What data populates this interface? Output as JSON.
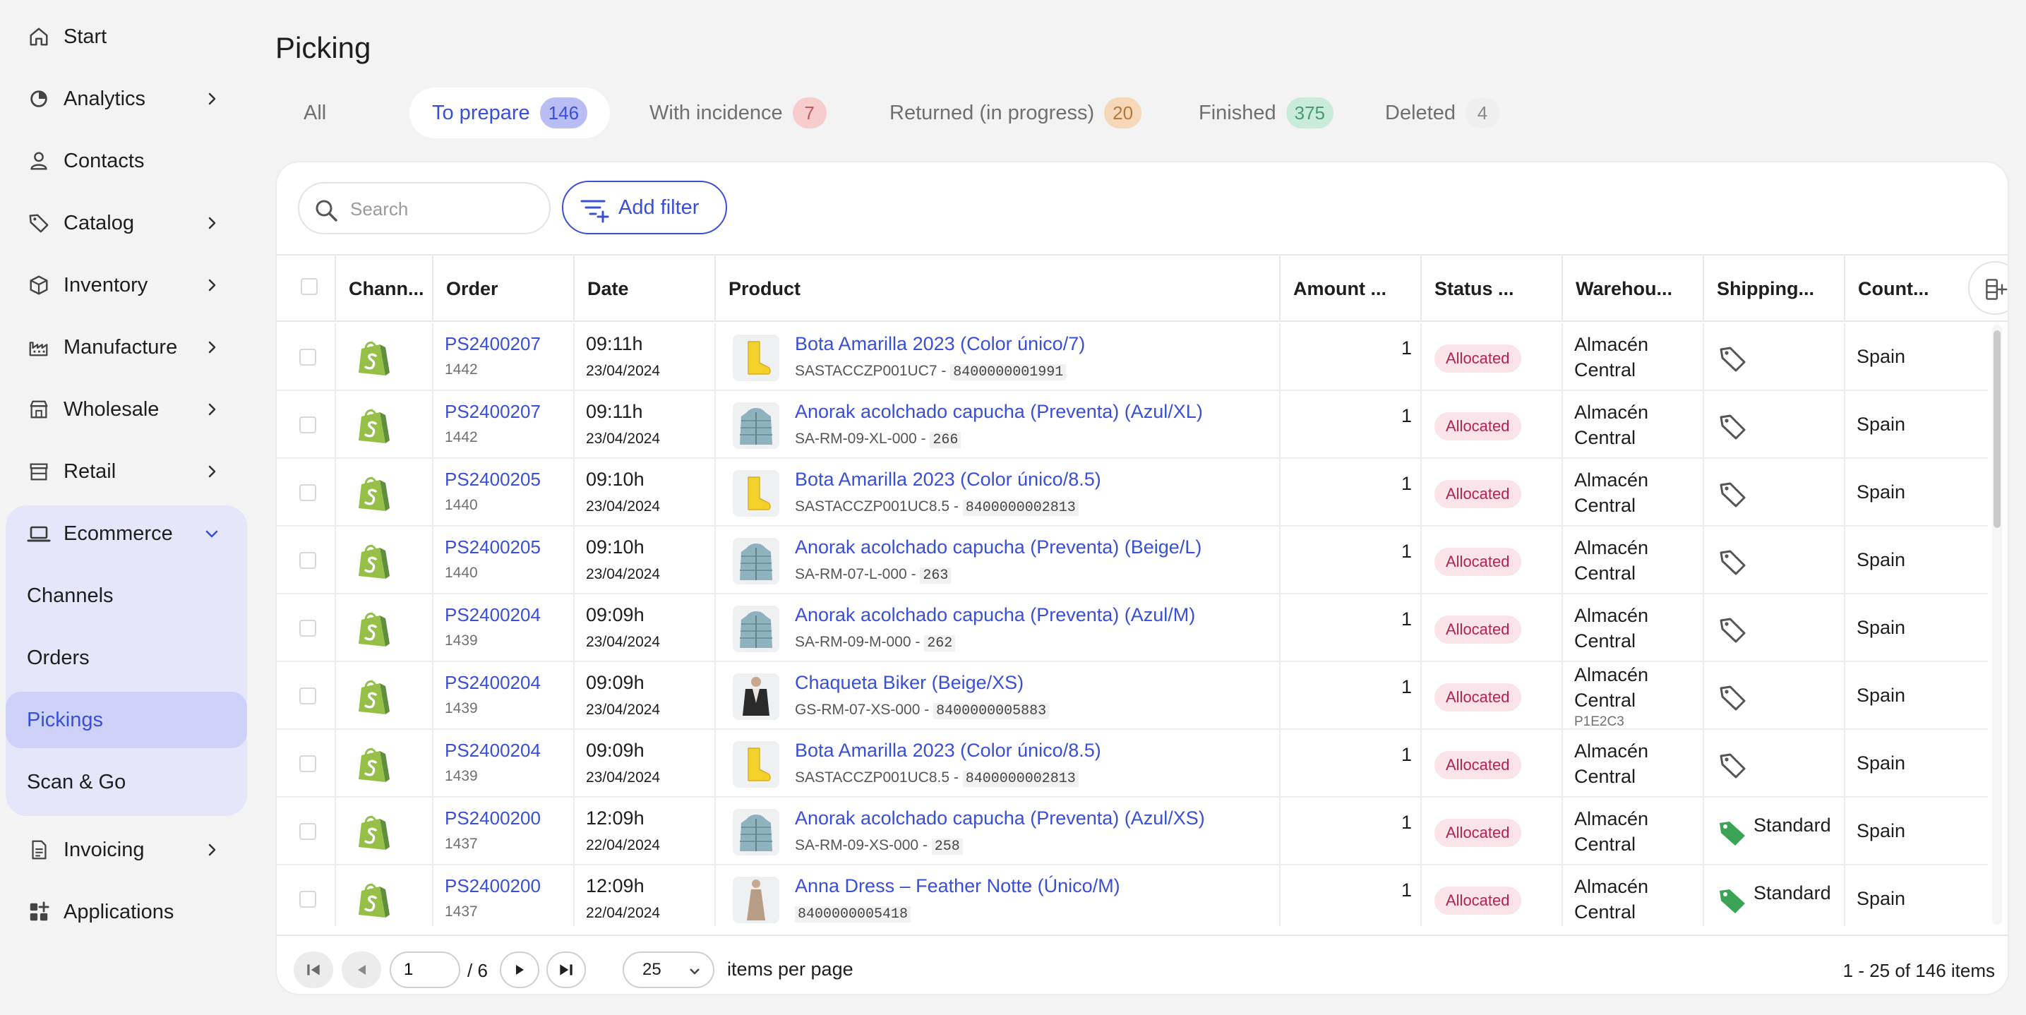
{
  "sidebar": {
    "items": [
      {
        "label": "Start",
        "icon": "home-icon",
        "chevron": false
      },
      {
        "label": "Analytics",
        "icon": "analytics-icon",
        "chevron": true
      },
      {
        "label": "Contacts",
        "icon": "contacts-icon",
        "chevron": false
      },
      {
        "label": "Catalog",
        "icon": "tag-icon",
        "chevron": true
      },
      {
        "label": "Inventory",
        "icon": "box-icon",
        "chevron": true
      },
      {
        "label": "Manufacture",
        "icon": "factory-icon",
        "chevron": true
      },
      {
        "label": "Wholesale",
        "icon": "store-icon",
        "chevron": true
      },
      {
        "label": "Retail",
        "icon": "shop-icon",
        "chevron": true
      }
    ],
    "ecommerce": {
      "label": "Ecommerce",
      "icon": "laptop-icon",
      "subitems": [
        "Channels",
        "Orders",
        "Pickings",
        "Scan & Go"
      ],
      "active": "Pickings"
    },
    "bottom_items": [
      {
        "label": "Invoicing",
        "icon": "document-icon",
        "chevron": true
      },
      {
        "label": "Applications",
        "icon": "apps-icon",
        "chevron": false
      }
    ]
  },
  "page": {
    "title": "Picking"
  },
  "tabs": [
    {
      "label": "All",
      "count": null
    },
    {
      "label": "To prepare",
      "count": "146",
      "badge_bg": "#b9bdf3",
      "badge_fg": "#3a4fd8",
      "active": true
    },
    {
      "label": "With incidence",
      "count": "7",
      "badge_bg": "#f6cccd",
      "badge_fg": "#c05a5e"
    },
    {
      "label": "Returned (in progress)",
      "count": "20",
      "badge_bg": "#f6d7b8",
      "badge_fg": "#b7763c"
    },
    {
      "label": "Finished",
      "count": "375",
      "badge_bg": "#c8ecd9",
      "badge_fg": "#4b9a6d"
    },
    {
      "label": "Deleted",
      "count": "4",
      "badge_bg": "#efefef",
      "badge_fg": "#8a8a8a"
    }
  ],
  "toolbar": {
    "search_placeholder": "Search",
    "add_filter_label": "Add filter"
  },
  "table": {
    "columns": [
      "Chann...",
      "Order",
      "Date",
      "Product",
      "Amount ...",
      "Status ...",
      "Warehou...",
      "Shipping...",
      "Count..."
    ],
    "rows": [
      {
        "order": "PS2400207",
        "order_sub": "1442",
        "time": "09:11h",
        "date": "23/04/2024",
        "product": "Bota Amarilla 2023 (Color único/7)",
        "sku": "SASTACCZP001UC7",
        "code": "8400000001991",
        "thumb": "boot",
        "amount": "1",
        "status": "Allocated",
        "warehouse": "Almacén Central",
        "wh_sub": "",
        "shipping": "",
        "ship_icon": "tag-outline",
        "country": "Spain"
      },
      {
        "order": "PS2400207",
        "order_sub": "1442",
        "time": "09:11h",
        "date": "23/04/2024",
        "product": "Anorak acolchado capucha (Preventa) (Azul/XL)",
        "sku": "SA-RM-09-XL-000",
        "code": "266",
        "thumb": "jacket",
        "amount": "1",
        "status": "Allocated",
        "warehouse": "Almacén Central",
        "wh_sub": "",
        "shipping": "",
        "ship_icon": "tag-outline",
        "country": "Spain"
      },
      {
        "order": "PS2400205",
        "order_sub": "1440",
        "time": "09:10h",
        "date": "23/04/2024",
        "product": "Bota Amarilla 2023 (Color único/8.5)",
        "sku": "SASTACCZP001UC8.5",
        "code": "8400000002813",
        "thumb": "boot",
        "amount": "1",
        "status": "Allocated",
        "warehouse": "Almacén Central",
        "wh_sub": "",
        "shipping": "",
        "ship_icon": "tag-outline",
        "country": "Spain"
      },
      {
        "order": "PS2400205",
        "order_sub": "1440",
        "time": "09:10h",
        "date": "23/04/2024",
        "product": "Anorak acolchado capucha (Preventa) (Beige/L)",
        "sku": "SA-RM-07-L-000",
        "code": "263",
        "thumb": "jacket",
        "amount": "1",
        "status": "Allocated",
        "warehouse": "Almacén Central",
        "wh_sub": "",
        "shipping": "",
        "ship_icon": "tag-outline",
        "country": "Spain"
      },
      {
        "order": "PS2400204",
        "order_sub": "1439",
        "time": "09:09h",
        "date": "23/04/2024",
        "product": "Anorak acolchado capucha (Preventa) (Azul/M)",
        "sku": "SA-RM-09-M-000",
        "code": "262",
        "thumb": "jacket",
        "amount": "1",
        "status": "Allocated",
        "warehouse": "Almacén Central",
        "wh_sub": "",
        "shipping": "",
        "ship_icon": "tag-outline",
        "country": "Spain"
      },
      {
        "order": "PS2400204",
        "order_sub": "1439",
        "time": "09:09h",
        "date": "23/04/2024",
        "product": "Chaqueta Biker (Beige/XS)",
        "sku": "GS-RM-07-XS-000",
        "code": "8400000005883",
        "thumb": "biker",
        "amount": "1",
        "status": "Allocated",
        "warehouse": "Almacén Central",
        "wh_sub": "P1E2C3",
        "shipping": "",
        "ship_icon": "tag-outline",
        "country": "Spain"
      },
      {
        "order": "PS2400204",
        "order_sub": "1439",
        "time": "09:09h",
        "date": "23/04/2024",
        "product": "Bota Amarilla 2023 (Color único/8.5)",
        "sku": "SASTACCZP001UC8.5",
        "code": "8400000002813",
        "thumb": "boot",
        "amount": "1",
        "status": "Allocated",
        "warehouse": "Almacén Central",
        "wh_sub": "",
        "shipping": "",
        "ship_icon": "tag-outline",
        "country": "Spain"
      },
      {
        "order": "PS2400200",
        "order_sub": "1437",
        "time": "12:09h",
        "date": "22/04/2024",
        "product": "Anorak acolchado capucha (Preventa) (Azul/XS)",
        "sku": "SA-RM-09-XS-000",
        "code": "258",
        "thumb": "jacket",
        "amount": "1",
        "status": "Allocated",
        "warehouse": "Almacén Central",
        "wh_sub": "",
        "shipping": "Standard",
        "ship_icon": "tag-green",
        "country": "Spain"
      },
      {
        "order": "PS2400200",
        "order_sub": "1437",
        "time": "12:09h",
        "date": "22/04/2024",
        "product": "Anna Dress – Feather Notte (Único/M)",
        "sku": "",
        "code": "8400000005418",
        "thumb": "dress",
        "amount": "1",
        "status": "Allocated",
        "warehouse": "Almacén Central",
        "wh_sub": "",
        "shipping": "Standard",
        "ship_icon": "tag-green",
        "country": "Spain"
      }
    ]
  },
  "pagination": {
    "page": "1",
    "total_pages": "/ 6",
    "per_page": "25",
    "per_page_label": "items per page",
    "range": "1 - 25 of 146 items"
  },
  "colors": {
    "accent": "#3a4fd8",
    "status_bg": "#fbe3ea",
    "status_fg": "#b3234e",
    "shopify_green": "#95bf47"
  }
}
